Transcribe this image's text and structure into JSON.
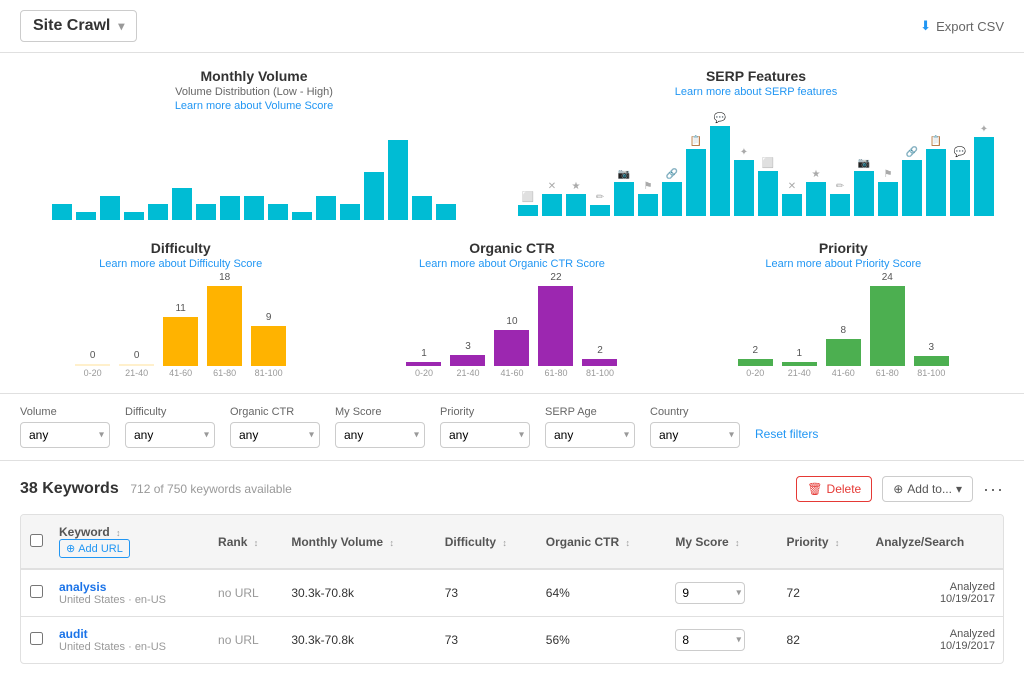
{
  "header": {
    "title": "Site Crawl",
    "dropdown_arrow": "▾",
    "export_label": "Export CSV"
  },
  "monthly_volume": {
    "title": "Monthly Volume",
    "subtitle": "Volume Distribution (Low - High)",
    "link": "Learn more about Volume Score",
    "bars": [
      2,
      1,
      3,
      1,
      2,
      4,
      2,
      3,
      3,
      2,
      1,
      3,
      2,
      6,
      10,
      3,
      2
    ]
  },
  "serp_features": {
    "title": "SERP Features",
    "link": "Learn more about SERP features",
    "bars": [
      1,
      2,
      2,
      1,
      3,
      2,
      3,
      6,
      8,
      5,
      4,
      2,
      3,
      2,
      4,
      3,
      5,
      6,
      5,
      7
    ]
  },
  "difficulty": {
    "title": "Difficulty",
    "link": "Learn more about Difficulty Score",
    "bars": [
      {
        "label": "0-20",
        "value": 0,
        "count": "0"
      },
      {
        "label": "21-40",
        "value": 0,
        "count": "0"
      },
      {
        "label": "41-60",
        "value": 55,
        "count": "11"
      },
      {
        "label": "61-80",
        "value": 90,
        "count": "18"
      },
      {
        "label": "81-100",
        "value": 45,
        "count": "9"
      }
    ]
  },
  "organic_ctr": {
    "title": "Organic CTR",
    "link": "Learn more about Organic CTR Score",
    "bars": [
      {
        "label": "0-20",
        "value": 5,
        "count": "1"
      },
      {
        "label": "21-40",
        "value": 15,
        "count": "3"
      },
      {
        "label": "41-60",
        "value": 50,
        "count": "10"
      },
      {
        "label": "61-80",
        "value": 110,
        "count": "22"
      },
      {
        "label": "81-100",
        "value": 10,
        "count": "2"
      }
    ]
  },
  "priority": {
    "title": "Priority",
    "link": "Learn more about Priority Score",
    "bars": [
      {
        "label": "0-20",
        "value": 10,
        "count": "2"
      },
      {
        "label": "21-40",
        "value": 5,
        "count": "1"
      },
      {
        "label": "41-60",
        "value": 40,
        "count": "8"
      },
      {
        "label": "61-80",
        "value": 120,
        "count": "24"
      },
      {
        "label": "81-100",
        "value": 15,
        "count": "3"
      }
    ]
  },
  "filters": {
    "volume_label": "Volume",
    "volume_value": "any",
    "difficulty_label": "Difficulty",
    "difficulty_value": "any",
    "organic_ctr_label": "Organic CTR",
    "organic_ctr_value": "any",
    "my_score_label": "My Score",
    "my_score_value": "any",
    "priority_label": "Priority",
    "priority_value": "any",
    "serp_age_label": "SERP Age",
    "serp_age_value": "any",
    "country_label": "Country",
    "country_value": "any",
    "reset_label": "Reset filters"
  },
  "keywords_section": {
    "count_label": "38 Keywords",
    "availability": "712 of 750 keywords available",
    "delete_label": "Delete",
    "add_to_label": "Add to...",
    "table": {
      "headers": [
        "",
        "Keyword",
        "Rank",
        "Monthly Volume",
        "Difficulty",
        "Organic CTR",
        "My Score",
        "Priority",
        "Analyze/Search"
      ],
      "add_url_label": "Add URL",
      "rows": [
        {
          "keyword": "analysis",
          "region": "United States · en-US",
          "rank": "no URL",
          "monthly_volume": "30.3k-70.8k",
          "difficulty": "73",
          "organic_ctr": "64%",
          "my_score": "9",
          "priority": "72",
          "analyzed": "Analyzed",
          "analyzed_date": "10/19/2017"
        },
        {
          "keyword": "audit",
          "region": "United States · en-US",
          "rank": "no URL",
          "monthly_volume": "30.3k-70.8k",
          "difficulty": "73",
          "organic_ctr": "56%",
          "my_score": "8",
          "priority": "82",
          "analyzed": "Analyzed",
          "analyzed_date": "10/19/2017"
        }
      ]
    }
  }
}
